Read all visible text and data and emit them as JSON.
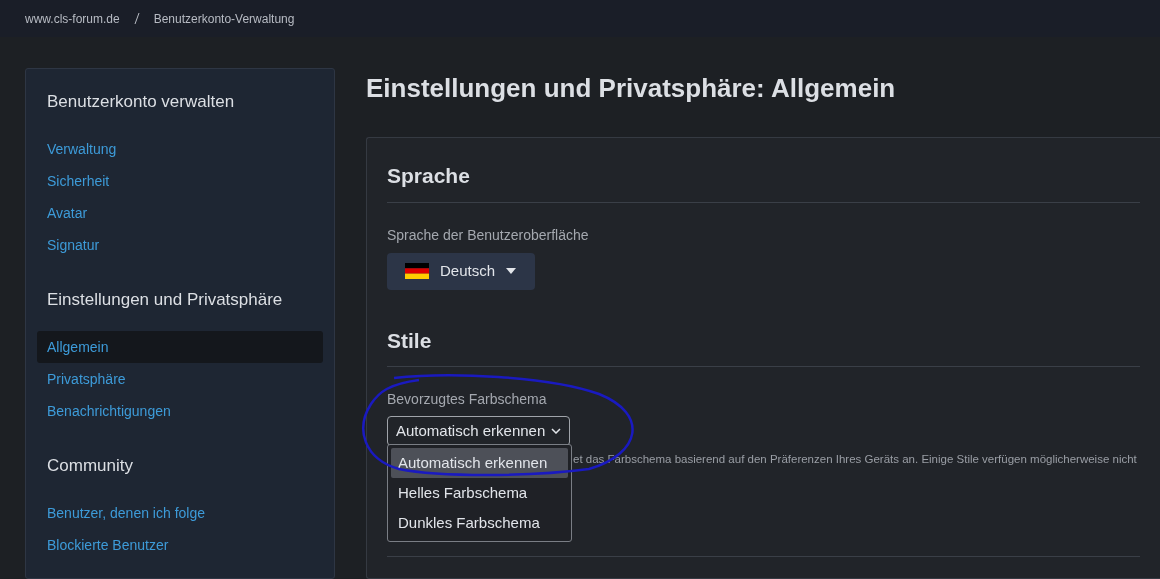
{
  "breadcrumb": [
    "www.cls-forum.de",
    "Benutzerkonto-Verwaltung"
  ],
  "sidebar": {
    "sections": [
      {
        "title": "Benutzerkonto verwalten",
        "items": [
          {
            "label": "Verwaltung",
            "selected": false
          },
          {
            "label": "Sicherheit",
            "selected": false
          },
          {
            "label": "Avatar",
            "selected": false
          },
          {
            "label": "Signatur",
            "selected": false
          }
        ]
      },
      {
        "title": "Einstellungen und Privatsphäre",
        "items": [
          {
            "label": "Allgemein",
            "selected": true
          },
          {
            "label": "Privatsphäre",
            "selected": false
          },
          {
            "label": "Benachrichtigungen",
            "selected": false
          }
        ]
      },
      {
        "title": "Community",
        "items": [
          {
            "label": "Benutzer, denen ich folge",
            "selected": false
          },
          {
            "label": "Blockierte Benutzer",
            "selected": false
          }
        ]
      }
    ]
  },
  "page_title": "Einstellungen und Privatsphäre: Allgemein",
  "language": {
    "heading": "Sprache",
    "label": "Sprache der Benutzeroberfläche",
    "value": "Deutsch"
  },
  "styles": {
    "heading": "Stile",
    "label": "Bevorzugtes Farbschema",
    "value": "Automatisch erkennen",
    "expanded": true,
    "options": [
      {
        "label": "Automatisch erkennen",
        "selected": true
      },
      {
        "label": "Helles Farbschema",
        "selected": false
      },
      {
        "label": "Dunkles Farbschema",
        "selected": false
      }
    ],
    "help": "et das Farbschema basierend auf den Präferenzen Ihres Geräts an. Einige Stile verfügen möglicherweise nicht"
  }
}
